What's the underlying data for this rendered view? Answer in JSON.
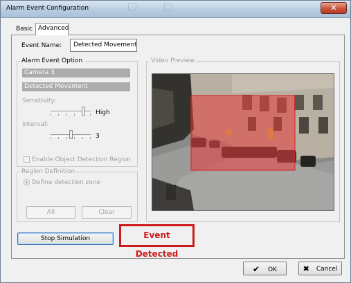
{
  "window": {
    "title": "Alarm Event Configuration",
    "close_glyph": "✕"
  },
  "tabs": [
    {
      "label": "Basic",
      "selected": false
    },
    {
      "label": "Advanced",
      "selected": true
    }
  ],
  "event_name": {
    "label": "Event Name:",
    "value": "Detected Movement"
  },
  "alarm_event_option": {
    "legend": "Alarm Event Option",
    "camera": "Camera 3",
    "event_type": "Detected Movement",
    "sensitivity": {
      "label": "Sensitivity:",
      "value_label": "High",
      "level": 0.85
    },
    "interval": {
      "label": "Interval:",
      "value_label": "3",
      "level": 0.5
    },
    "enable_region": {
      "label": "Enable Object Detection Region",
      "checked": false
    }
  },
  "region_definition": {
    "legend": "Region Definition",
    "define_zone": {
      "label": "Define detection zone",
      "selected": true
    },
    "all_button": "All",
    "clear_button": "Clear"
  },
  "video_preview": {
    "legend": "Video Preview"
  },
  "simulation": {
    "stop_button": "Stop Simulation",
    "status_text": "Event Detected",
    "status_color": "#cc1b1b"
  },
  "footer": {
    "ok_label": "OK",
    "ok_icon": "checkmark-icon",
    "cancel_label": "Cancel",
    "cancel_icon": "x-icon"
  },
  "colors": {
    "selection_bar": "#acacac",
    "detection_region": "#e53a3a",
    "title_bar": "#b9cde1"
  }
}
